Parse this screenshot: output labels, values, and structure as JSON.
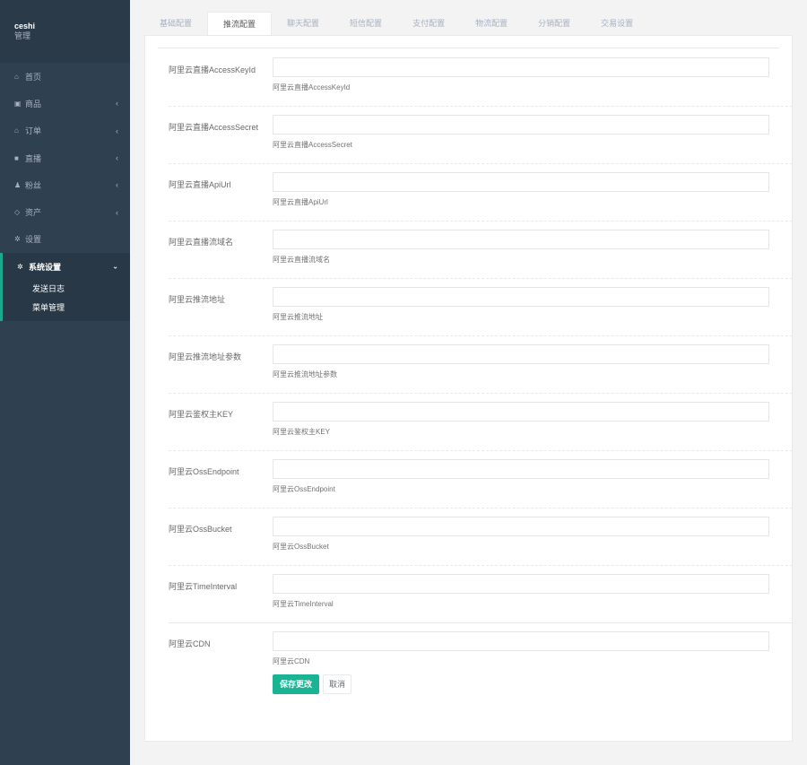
{
  "profile": {
    "name": "ceshi",
    "role": "管理"
  },
  "sidebar": {
    "items": [
      {
        "label": "首页",
        "icon": "home-icon",
        "glyph": "⌂",
        "chevron": ""
      },
      {
        "label": "商品",
        "icon": "product-icon",
        "glyph": "▣",
        "chevron": "‹"
      },
      {
        "label": "订单",
        "icon": "bank-icon",
        "glyph": "⌂",
        "chevron": "‹"
      },
      {
        "label": "直播",
        "icon": "video-icon",
        "glyph": "■",
        "chevron": "‹"
      },
      {
        "label": "粉丝",
        "icon": "user-icon",
        "glyph": "♟",
        "chevron": "‹"
      },
      {
        "label": "资产",
        "icon": "diamond-icon",
        "glyph": "◇",
        "chevron": "‹"
      },
      {
        "label": "设置",
        "icon": "gear-icon",
        "glyph": "✲",
        "chevron": ""
      }
    ],
    "active": {
      "label": "系统设置",
      "icon": "gear-icon",
      "glyph": "✲",
      "chevron": "⌄",
      "children": [
        "发送日志",
        "菜单管理"
      ]
    }
  },
  "tabs": [
    "基础配置",
    "推流配置",
    "聊天配置",
    "短信配置",
    "支付配置",
    "物流配置",
    "分销配置",
    "交易设置"
  ],
  "active_tab": "推流配置",
  "form": {
    "fields": [
      {
        "label": "阿里云直播AccessKeyId",
        "value": "",
        "help": "阿里云直播AccessKeyId"
      },
      {
        "label": "阿里云直播AccessSecret",
        "value": "",
        "help": "阿里云直播AccessSecret"
      },
      {
        "label": "阿里云直播ApiUrl",
        "value": "",
        "help": "阿里云直播ApiUrl"
      },
      {
        "label": "阿里云直播流域名",
        "value": "",
        "help": "阿里云直播流域名"
      },
      {
        "label": "阿里云推流地址",
        "value": "",
        "help": "阿里云推流地址"
      },
      {
        "label": "阿里云推流地址参数",
        "value": "",
        "help": "阿里云推流地址参数"
      },
      {
        "label": "阿里云鉴权主KEY",
        "value": "",
        "help": "阿里云鉴权主KEY"
      },
      {
        "label": "阿里云OssEndpoint",
        "value": "",
        "help": "阿里云OssEndpoint"
      },
      {
        "label": "阿里云OssBucket",
        "value": "",
        "help": "阿里云OssBucket"
      },
      {
        "label": "阿里云TimeInterval",
        "value": "",
        "help": "阿里云TimeInterval"
      },
      {
        "label": "阿里云CDN",
        "value": "",
        "help": "阿里云CDN"
      }
    ],
    "save_label": "保存更改",
    "cancel_label": "取消"
  },
  "colors": {
    "sidebar_bg": "#2f4050",
    "accent": "#1ab394",
    "page_bg": "#f3f3f4"
  }
}
